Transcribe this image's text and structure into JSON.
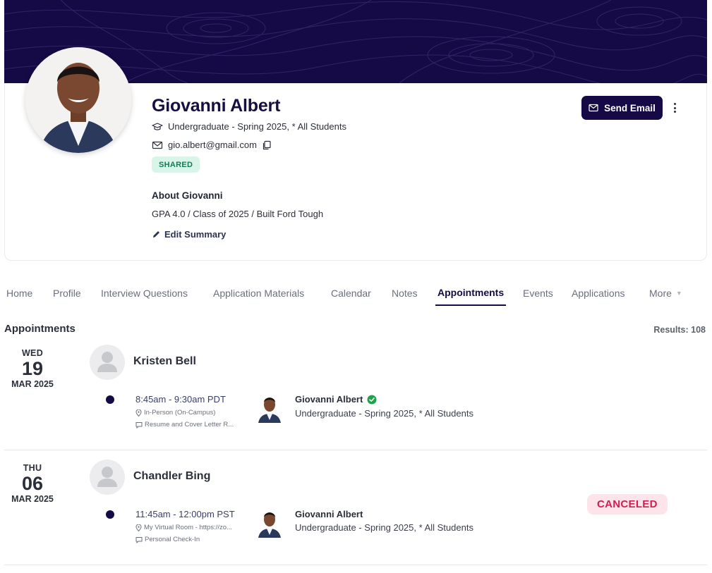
{
  "profile": {
    "name": "Giovanni Albert",
    "program": "Undergraduate - Spring 2025, * All Students",
    "email": "gio.albert@gmail.com",
    "badge": "SHARED",
    "about_title": "About Giovanni",
    "about_text": "GPA 4.0 / Class of 2025 / Built Ford Tough",
    "edit_summary": "Edit Summary",
    "send_email": "Send Email"
  },
  "tabs": [
    {
      "label": "Home"
    },
    {
      "label": "Profile"
    },
    {
      "label": "Interview Questions"
    },
    {
      "label": "Application Materials"
    },
    {
      "label": "Calendar"
    },
    {
      "label": "Notes"
    },
    {
      "label": "Appointments",
      "active": true
    },
    {
      "label": "Events"
    },
    {
      "label": "Applications"
    },
    {
      "label": "More"
    }
  ],
  "appointments_section": {
    "title": "Appointments",
    "results": "Results: 108"
  },
  "appointments": [
    {
      "dow": "WED",
      "day": "19",
      "month": "MAR 2025",
      "advisor": "Kristen Bell",
      "time": "8:45am - 9:30am PDT",
      "location": "In-Person (On-Campus)",
      "topic": "Resume and Cover Letter R...",
      "student": "Giovanni Albert",
      "student_program": "Undergraduate - Spring 2025, * All Students",
      "verified": true,
      "status": ""
    },
    {
      "dow": "THU",
      "day": "06",
      "month": "MAR 2025",
      "advisor": "Chandler Bing",
      "time": "11:45am - 12:00pm PST",
      "location": "My Virtual Room - https://zo...",
      "topic": "Personal Check-In",
      "student": "Giovanni Albert",
      "student_program": "Undergraduate - Spring 2025, * All Students",
      "verified": false,
      "status": "CANCELED"
    }
  ],
  "colors": {
    "brand": "#150a45",
    "shared_bg": "#d9f5ea",
    "shared_text": "#157a55",
    "canceled_bg": "#fde3ea",
    "canceled_text": "#d21f4f",
    "verified": "#1fa34a"
  }
}
